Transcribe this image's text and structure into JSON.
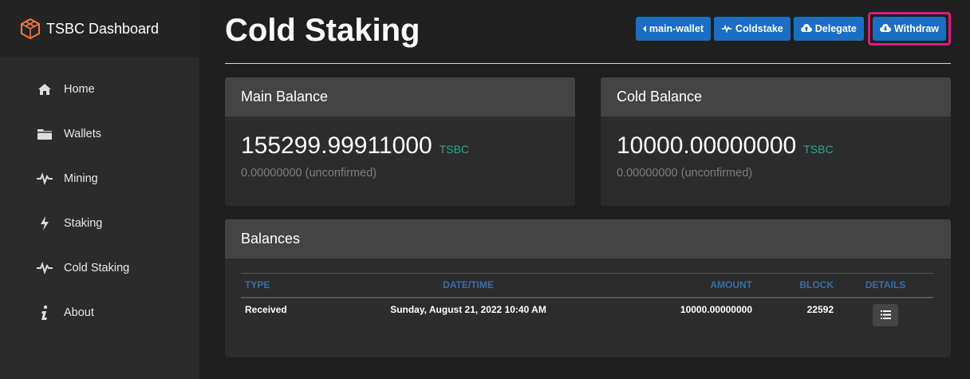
{
  "app": {
    "title": "TSBC Dashboard"
  },
  "sidebar": {
    "items": [
      {
        "label": "Home",
        "icon": "home-icon"
      },
      {
        "label": "Wallets",
        "icon": "folder-icon"
      },
      {
        "label": "Mining",
        "icon": "pulse-icon"
      },
      {
        "label": "Staking",
        "icon": "bolt-icon"
      },
      {
        "label": "Cold Staking",
        "icon": "pulse-icon"
      },
      {
        "label": "About",
        "icon": "info-icon"
      }
    ]
  },
  "header": {
    "title": "Cold Staking",
    "buttons": {
      "wallet": "main-wallet",
      "coldstake": "Coldstake",
      "delegate": "Delegate",
      "withdraw": "Withdraw"
    }
  },
  "main_balance": {
    "title": "Main Balance",
    "value": "155299.99911000",
    "unit": "TSBC",
    "unconfirmed": "0.00000000 (unconfirmed)"
  },
  "cold_balance": {
    "title": "Cold Balance",
    "value": "10000.00000000",
    "unit": "TSBC",
    "unconfirmed": "0.00000000 (unconfirmed)"
  },
  "balances": {
    "title": "Balances",
    "columns": {
      "type": "TYPE",
      "datetime": "DATE/TIME",
      "amount": "AMOUNT",
      "block": "BLOCK",
      "details": "DETAILS"
    },
    "rows": [
      {
        "type": "Received",
        "datetime": "Sunday, August 21, 2022 10:40 AM",
        "amount": "10000.00000000",
        "block": "22592"
      }
    ]
  },
  "colors": {
    "accent": "#1b6ec2",
    "unit": "#2aa88a",
    "highlight": "#e0197d",
    "header_text": "#3a6ea8"
  }
}
